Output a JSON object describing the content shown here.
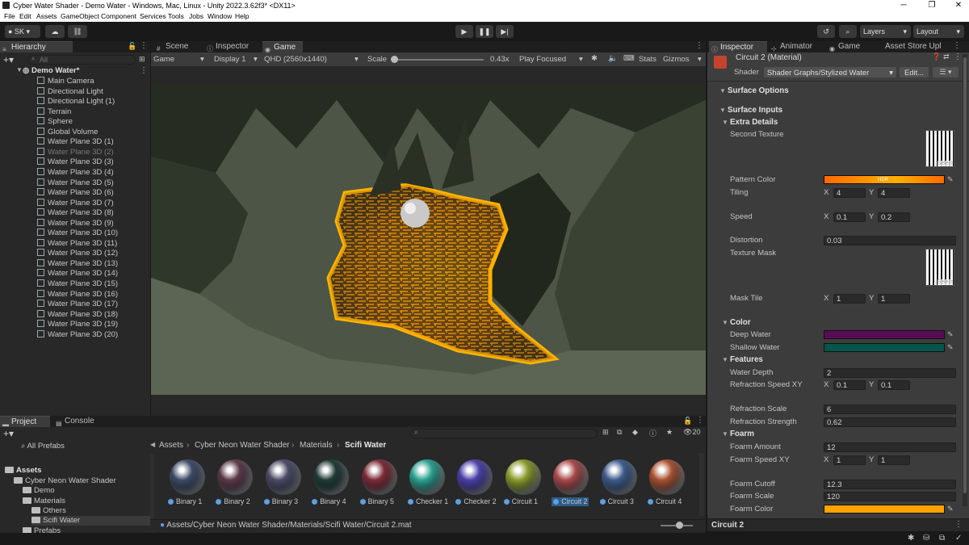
{
  "window": {
    "title": "Cyber Water Shader - Demo Water - Windows, Mac, Linux - Unity 2022.3.62f3* <DX11>",
    "minimize": "─",
    "maximize": "❐",
    "close": "✕"
  },
  "menu": [
    "File",
    "Edit",
    "Assets",
    "GameObject",
    "Component",
    "Services",
    "Tools",
    "Jobs",
    "Window",
    "Help"
  ],
  "toolbar": {
    "account": "SK",
    "layers": "Layers",
    "layout": "Layout"
  },
  "hierarchy": {
    "tab": "Hierarchy",
    "search_placeholder": "All",
    "scene": "Demo Water*",
    "items": [
      {
        "label": "Main Camera",
        "dim": false
      },
      {
        "label": "Directional Light",
        "dim": false
      },
      {
        "label": "Directional Light (1)",
        "dim": false
      },
      {
        "label": "Terrain",
        "dim": false
      },
      {
        "label": "Sphere",
        "dim": false
      },
      {
        "label": "Global Volume",
        "dim": false
      },
      {
        "label": "Water Plane 3D (1)",
        "dim": false
      },
      {
        "label": "Water Plane 3D (2)",
        "dim": true
      },
      {
        "label": "Water Plane 3D (3)",
        "dim": false
      },
      {
        "label": "Water Plane 3D (4)",
        "dim": false
      },
      {
        "label": "Water Plane 3D (5)",
        "dim": false
      },
      {
        "label": "Water Plane 3D (6)",
        "dim": false
      },
      {
        "label": "Water Plane 3D (7)",
        "dim": false
      },
      {
        "label": "Water Plane 3D (8)",
        "dim": false
      },
      {
        "label": "Water Plane 3D (9)",
        "dim": false
      },
      {
        "label": "Water Plane 3D (10)",
        "dim": false
      },
      {
        "label": "Water Plane 3D (11)",
        "dim": false
      },
      {
        "label": "Water Plane 3D (12)",
        "dim": false
      },
      {
        "label": "Water Plane 3D (13)",
        "dim": false
      },
      {
        "label": "Water Plane 3D (14)",
        "dim": false
      },
      {
        "label": "Water Plane 3D (15)",
        "dim": false
      },
      {
        "label": "Water Plane 3D (16)",
        "dim": false
      },
      {
        "label": "Water Plane 3D (17)",
        "dim": false
      },
      {
        "label": "Water Plane 3D (18)",
        "dim": false
      },
      {
        "label": "Water Plane 3D (19)",
        "dim": false
      },
      {
        "label": "Water Plane 3D (20)",
        "dim": false
      }
    ]
  },
  "center_tabs": {
    "scene": "Scene",
    "inspector": "Inspector",
    "game": "Game"
  },
  "game_bar": {
    "game": "Game",
    "display": "Display 1",
    "resolution": "QHD (2560x1440)",
    "scale_label": "Scale",
    "scale_value": "0.43x",
    "play_mode": "Play Focused",
    "stats": "Stats",
    "gizmos": "Gizmos"
  },
  "inspector": {
    "tabs": {
      "inspector": "Inspector",
      "animator": "Animator",
      "game": "Game",
      "asset_store": "Asset Store Upl"
    },
    "material_name": "Circuit 2 (Material)",
    "shader_label": "Shader",
    "shader_value": "Shader Graphs/Stylized Water",
    "edit": "Edit...",
    "surface_options": "Surface Options",
    "surface_inputs": "Surface Inputs",
    "extra_details": "Extra Details",
    "second_texture": "Second Texture",
    "select": "Select",
    "pattern_color": "Pattern Color",
    "hdr": "HDR",
    "tiling": "Tiling",
    "tiling_x": "4",
    "tiling_y": "4",
    "speed": "Speed",
    "speed_x": "0.1",
    "speed_y": "0.2",
    "distortion": "Distortion",
    "distortion_value": "0.03",
    "texture_mask": "Texture Mask",
    "mask_tile": "Mask Tile",
    "mask_x": "1",
    "mask_y": "1",
    "color_header": "Color",
    "deep_water": "Deep Water",
    "shallow_water": "Shallow Water",
    "features": "Features",
    "water_depth": "Water Depth",
    "water_depth_value": "2",
    "refraction_speed": "Refraction Speed XY",
    "refraction_x": "0.1",
    "refraction_y": "0.1",
    "refraction_scale": "Refraction Scale",
    "refraction_scale_value": "6",
    "refraction_strength": "Refraction Strength",
    "refraction_strength_value": "0.62",
    "foam_header": "Foarm",
    "foam_amount": "Foarm Amount",
    "foam_amount_value": "12",
    "foam_speed": "Foarm Speed XY",
    "foam_speed_x": "1",
    "foam_speed_y": "1",
    "foam_cutoff": "Foarm Cutoff",
    "foam_cutoff_value": "12.3",
    "foam_scale": "Foarm Scale",
    "foam_scale_value": "120",
    "foam_color": "Foarm Color",
    "x": "X",
    "y": "Y",
    "footer": "Circuit 2",
    "colors": {
      "pattern": "#ff8a00",
      "deep": "#5a0b55",
      "shallow": "#03564a",
      "foam": "#ffa200"
    }
  },
  "project": {
    "tab_project": "Project",
    "tab_console": "Console",
    "all_prefabs": "All Prefabs",
    "tree": [
      {
        "label": "Assets",
        "level": 0,
        "bold": true
      },
      {
        "label": "Cyber Neon Water Shader",
        "level": 1,
        "bold": false
      },
      {
        "label": "Demo",
        "level": 2,
        "bold": false
      },
      {
        "label": "Materials",
        "level": 2,
        "bold": false
      },
      {
        "label": "Others",
        "level": 3,
        "bold": false
      },
      {
        "label": "Scifi Water",
        "level": 3,
        "bold": false
      },
      {
        "label": "Prefabs",
        "level": 2,
        "bold": false
      }
    ],
    "breadcrumb": [
      "Assets",
      "Cyber Neon Water Shader",
      "Materials",
      "Scifi Water"
    ],
    "count": "20",
    "materials": [
      {
        "label": "Binary 1",
        "color": "#3d4a66"
      },
      {
        "label": "Binary 2",
        "color": "#5a3848"
      },
      {
        "label": "Binary 3",
        "color": "#4a4a66"
      },
      {
        "label": "Binary 4",
        "color": "#1f3a35"
      },
      {
        "label": "Binary 5",
        "color": "#7a2a35"
      },
      {
        "label": "Checker 1",
        "color": "#2aa08f"
      },
      {
        "label": "Checker 2",
        "color": "#4a3fa8"
      },
      {
        "label": "Circuit 1",
        "color": "#8a9a2a"
      },
      {
        "label": "Circuit 2",
        "color": "#a84848"
      },
      {
        "label": "Circuit 3",
        "color": "#3d5a8a"
      },
      {
        "label": "Circuit 4",
        "color": "#a85030"
      }
    ],
    "path": "Assets/Cyber Neon Water Shader/Materials/Scifi Water/Circuit 2.mat"
  }
}
